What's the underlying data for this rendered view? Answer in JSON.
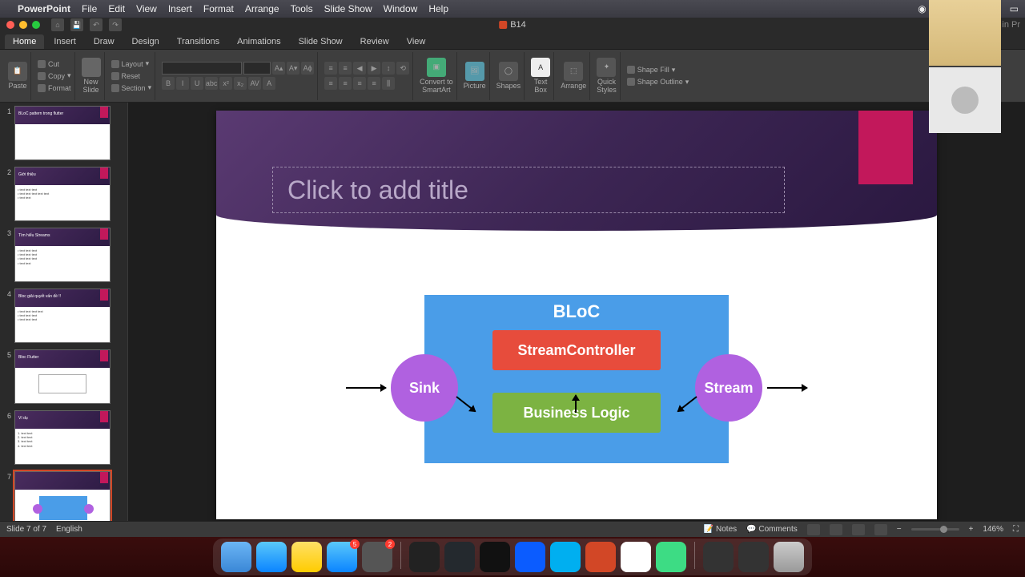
{
  "menubar": {
    "app": "PowerPoint",
    "items": [
      "File",
      "Edit",
      "View",
      "Insert",
      "Format",
      "Arrange",
      "Tools",
      "Slide Show",
      "Window",
      "Help"
    ]
  },
  "window": {
    "title": "B14",
    "search_placeholder": "Search in Pr"
  },
  "ribbon_tabs": [
    "Home",
    "Insert",
    "Draw",
    "Design",
    "Transitions",
    "Animations",
    "Slide Show",
    "Review",
    "View"
  ],
  "ribbon": {
    "paste": "Paste",
    "cut": "Cut",
    "copy": "Copy",
    "format": "Format",
    "new_slide": "New\nSlide",
    "layout": "Layout",
    "reset": "Reset",
    "section": "Section",
    "convert": "Convert to\nSmartArt",
    "picture": "Picture",
    "shapes": "Shapes",
    "textbox": "Text\nBox",
    "arrange": "Arrange",
    "quick": "Quick\nStyles",
    "shape_fill": "Shape Fill",
    "shape_outline": "Shape Outline"
  },
  "thumbs": [
    {
      "n": "1",
      "title": "BLoC pattern trong flutter"
    },
    {
      "n": "2",
      "title": "Giới thiệu"
    },
    {
      "n": "3",
      "title": "Tìm hiểu Streams"
    },
    {
      "n": "4",
      "title": "Bloc giải quyết vấn đề !!"
    },
    {
      "n": "5",
      "title": "Bloc Flutter"
    },
    {
      "n": "6",
      "title": "Ví dụ"
    },
    {
      "n": "7",
      "title": ""
    }
  ],
  "slide": {
    "title_placeholder": "Click to add title",
    "diagram": {
      "bloc": "BLoC",
      "stream_controller": "StreamController",
      "business_logic": "Business Logic",
      "sink": "Sink",
      "stream": "Stream"
    }
  },
  "status": {
    "slide_info": "Slide 7 of 7",
    "language": "English",
    "notes": "Notes",
    "comments": "Comments",
    "zoom": "146%"
  },
  "dock": {
    "badges": {
      "appstore": "5",
      "settings": "2"
    }
  }
}
